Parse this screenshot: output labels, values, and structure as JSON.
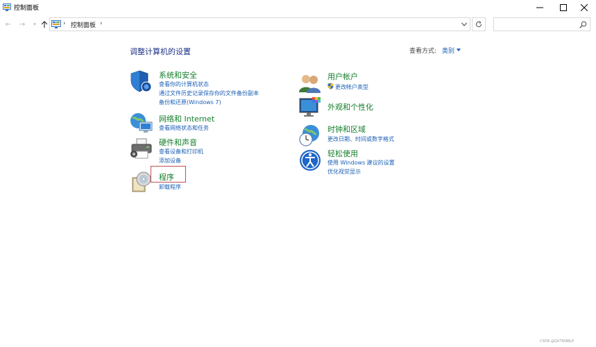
{
  "window": {
    "title": "控制面板"
  },
  "address": {
    "crumb": "控制面板",
    "sep": "›",
    "search_placeholder": ""
  },
  "main": {
    "heading": "调整计算机的设置",
    "view_by_label": "查看方式:",
    "view_by_value": "类别"
  },
  "categories": [
    {
      "title": "系统和安全",
      "icon": "shield-icon",
      "links": [
        "查看你的计算机状态",
        "通过文件历史记录保存你的文件备份副本",
        "备份和还原(Windows 7)"
      ]
    },
    {
      "title": "网络和 Internet",
      "icon": "network-globe-icon",
      "links": [
        "查看网络状态和任务"
      ]
    },
    {
      "title": "硬件和声音",
      "icon": "printer-icon",
      "links": [
        "查看设备和打印机",
        "添加设备"
      ]
    },
    {
      "title": "程序",
      "icon": "programs-disc-icon",
      "links": [
        "卸载程序"
      ]
    },
    {
      "title": "用户帐户",
      "icon": "users-icon",
      "links": [
        "更改帐户类型"
      ]
    },
    {
      "title": "外观和个性化",
      "icon": "monitor-palette-icon",
      "links": []
    },
    {
      "title": "时钟和区域",
      "icon": "clock-globe-icon",
      "links": [
        "更改日期、时间或数字格式"
      ]
    },
    {
      "title": "轻松使用",
      "icon": "accessibility-icon",
      "links": [
        "使用 Windows 建议的设置",
        "优化视觉显示"
      ]
    }
  ],
  "colors": {
    "category_title": "#127d28",
    "link": "#1a5fb4",
    "heading": "#1e3287",
    "highlight": "#c0504d"
  },
  "watermark": "CSDN @QUTRIBBLE"
}
